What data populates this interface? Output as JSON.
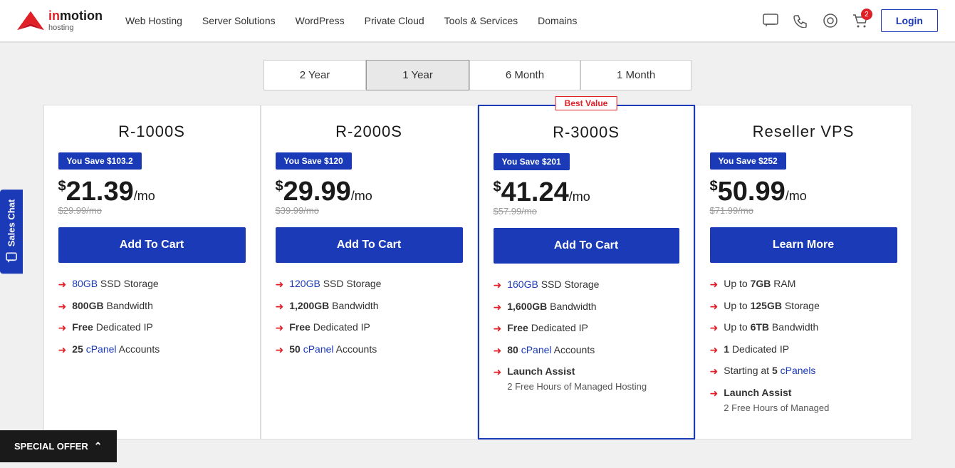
{
  "header": {
    "logo_top": "inmotion",
    "logo_bottom": "hosting",
    "nav_items": [
      "Web Hosting",
      "Server Solutions",
      "WordPress",
      "Private Cloud",
      "Tools & Services",
      "Domains"
    ],
    "login_label": "Login",
    "cart_count": "2"
  },
  "billing_tabs": [
    {
      "label": "2 Year",
      "active": false
    },
    {
      "label": "1 Year",
      "active": true
    },
    {
      "label": "6 Month",
      "active": false
    },
    {
      "label": "1 Month",
      "active": false
    }
  ],
  "plans": [
    {
      "id": "r1000s",
      "name": "R-1000S",
      "savings": "You Save $103.2",
      "price_currency": "$",
      "price_amount": "21.39",
      "price_period": "/mo",
      "price_original": "$29.99/mo",
      "button_label": "Add To Cart",
      "featured": false,
      "features": [
        {
          "highlight": "80GB",
          "text": " SSD Storage",
          "bold": false
        },
        {
          "highlight": "",
          "text": "800GB Bandwidth",
          "bold": false
        },
        {
          "highlight": "",
          "text": "Free Dedicated IP",
          "prefix_bold": "Free"
        },
        {
          "highlight": "25",
          "text": " cPanel Accounts",
          "prefix_bold": "25",
          "cpanel_link": "cPanel"
        }
      ]
    },
    {
      "id": "r2000s",
      "name": "R-2000S",
      "savings": "You Save $120",
      "price_currency": "$",
      "price_amount": "29.99",
      "price_period": "/mo",
      "price_original": "$39.99/mo",
      "button_label": "Add To Cart",
      "featured": false,
      "features": [
        {
          "highlight": "120GB",
          "text": " SSD Storage"
        },
        {
          "highlight": "",
          "text": "1,200GB Bandwidth",
          "prefix_bold": "1,200GB"
        },
        {
          "highlight": "",
          "text": "Free Dedicated IP",
          "prefix_bold": "Free"
        },
        {
          "highlight": "50",
          "text": " cPanel Accounts",
          "cpanel_link": "cPanel"
        }
      ]
    },
    {
      "id": "r3000s",
      "name": "R-3000S",
      "savings": "You Save $201",
      "price_currency": "$",
      "price_amount": "41.24",
      "price_period": "/mo",
      "price_original": "$57.99/mo",
      "button_label": "Add To Cart",
      "featured": true,
      "best_value": "Best Value",
      "features": [
        {
          "highlight": "160GB",
          "text": " SSD Storage"
        },
        {
          "highlight": "",
          "text": "1,600GB Bandwidth",
          "prefix_bold": "1,600GB"
        },
        {
          "highlight": "",
          "text": "Free Dedicated IP",
          "prefix_bold": "Free"
        },
        {
          "highlight": "80",
          "text": " cPanel Accounts",
          "cpanel_link": "cPanel"
        },
        {
          "highlight": "",
          "text": "Launch Assist",
          "prefix_bold": "Launch Assist",
          "sub": "2 Free Hours of Managed Hosting"
        }
      ]
    },
    {
      "id": "reseller-vps",
      "name": "Reseller VPS",
      "savings": "You Save $252",
      "price_currency": "$",
      "price_amount": "50.99",
      "price_period": "/mo",
      "price_original": "$71.99/mo",
      "button_label": "Learn More",
      "featured": false,
      "features": [
        {
          "highlight": "",
          "text": "Up to 7GB RAM",
          "prefix_bold": "7GB"
        },
        {
          "highlight": "",
          "text": "Up to 125GB Storage",
          "prefix_bold": "125GB"
        },
        {
          "highlight": "",
          "text": "Up to 6TB Bandwidth",
          "prefix_bold": "6TB"
        },
        {
          "highlight": "",
          "text": "1 Dedicated IP",
          "prefix_bold": "1"
        },
        {
          "highlight": "",
          "text": "Starting at 5 cPanels",
          "prefix_bold": "5",
          "cpanel_link": "cPanels"
        },
        {
          "highlight": "",
          "text": "Launch Assist",
          "prefix_bold": "Launch Assist",
          "sub": "2 Free Hours of Managed"
        }
      ]
    }
  ],
  "sales_chat": "Sales Chat",
  "special_offer": "SPECIAL OFFER"
}
